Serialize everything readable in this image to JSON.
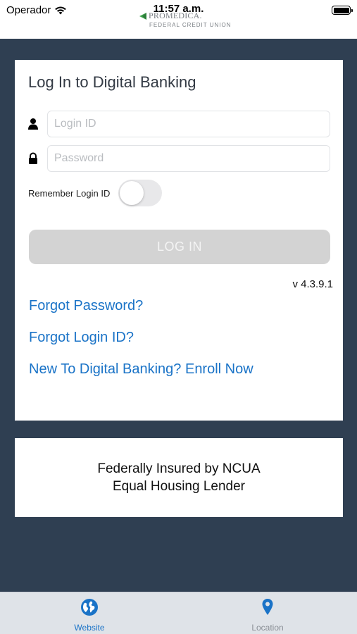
{
  "status_bar": {
    "carrier": "Operador",
    "time": "11:57 a.m."
  },
  "brand": {
    "name": "PROMEDICA.",
    "subtitle": "FEDERAL CREDIT UNION"
  },
  "login": {
    "title": "Log In to Digital Banking",
    "login_id_placeholder": "Login ID",
    "password_placeholder": "Password",
    "remember_label": "Remember Login ID",
    "remember_on": false,
    "button_label": "LOG IN",
    "version": "v 4.3.9.1",
    "links": {
      "forgot_password": "Forgot Password?",
      "forgot_login_id": "Forgot Login ID?",
      "enroll": "New To Digital Banking? Enroll Now"
    }
  },
  "notice": {
    "line1": "Federally Insured by NCUA",
    "line2": "Equal Housing Lender"
  },
  "tabs": [
    {
      "label": "Website",
      "icon": "globe-icon",
      "active": true
    },
    {
      "label": "Location",
      "icon": "map-pin-icon",
      "active": false
    }
  ],
  "colors": {
    "background": "#2f3f52",
    "link": "#1a73c7",
    "tab_active": "#1a73c7",
    "tab_inactive": "#8a8f96",
    "brand_green": "#3fa34d"
  }
}
